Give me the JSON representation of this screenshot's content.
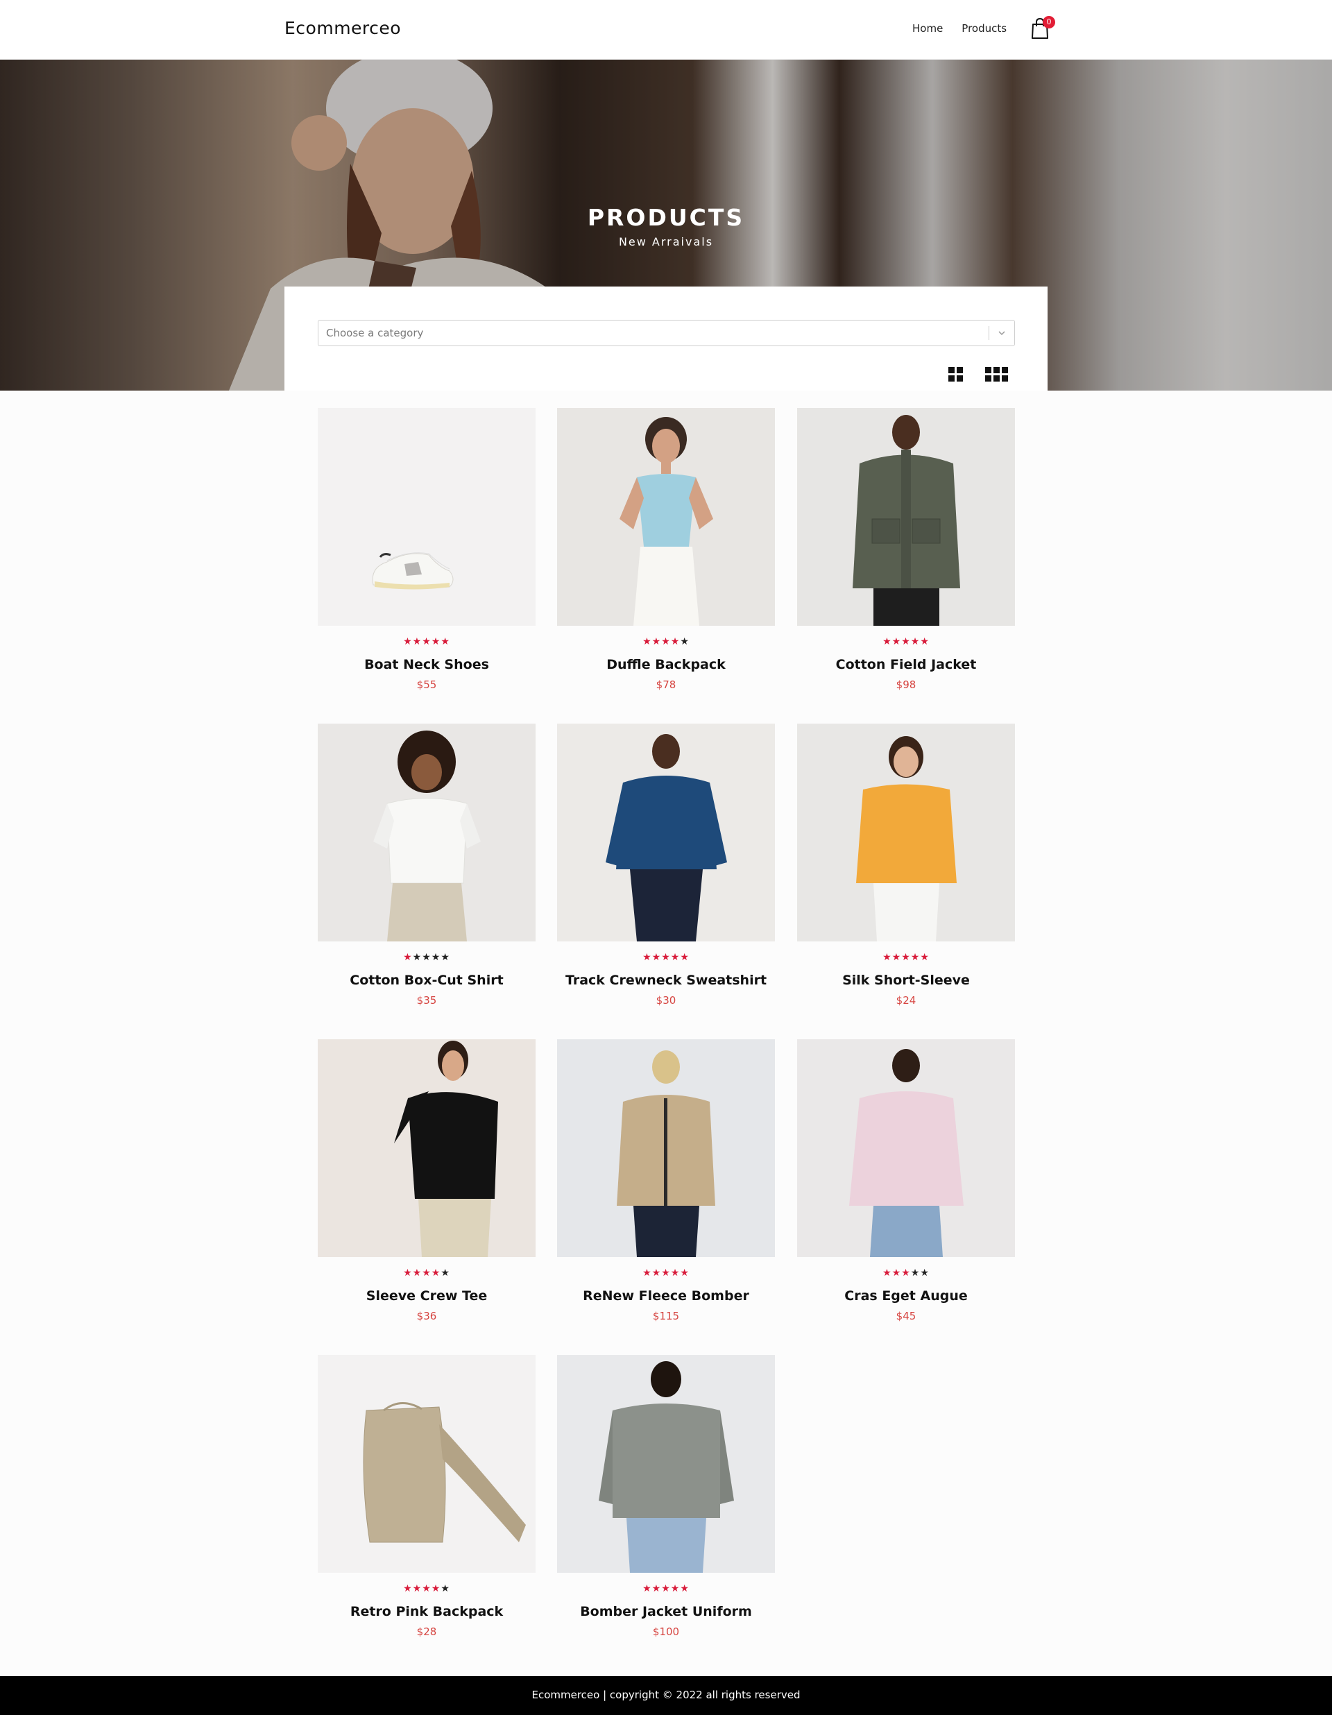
{
  "header": {
    "brand": "Ecommerceo",
    "nav": [
      {
        "label": "Home"
      },
      {
        "label": "Products"
      }
    ],
    "cart_count": "0"
  },
  "hero": {
    "title": "PRODUCTS",
    "subtitle": "New Arraivals"
  },
  "filters": {
    "category_placeholder": "Choose a category",
    "view_options": [
      {
        "icon": "grid-2x2-icon"
      },
      {
        "icon": "grid-3x2-icon"
      }
    ]
  },
  "colors": {
    "accent": "#e21d35",
    "star_filled": "#d81b3a",
    "star_empty": "#222222",
    "price": "#d64541"
  },
  "products": [
    {
      "name": "Boat Neck Shoes",
      "price": "$55",
      "rating": 5
    },
    {
      "name": "Duffle Backpack",
      "price": "$78",
      "rating": 4
    },
    {
      "name": "Cotton Field Jacket",
      "price": "$98",
      "rating": 5
    },
    {
      "name": "Cotton Box-Cut Shirt",
      "price": "$35",
      "rating": 1
    },
    {
      "name": "Track Crewneck Sweatshirt",
      "price": "$30",
      "rating": 5
    },
    {
      "name": "Silk Short-Sleeve",
      "price": "$24",
      "rating": 5
    },
    {
      "name": "Sleeve Crew Tee",
      "price": "$36",
      "rating": 4
    },
    {
      "name": "ReNew Fleece Bomber",
      "price": "$115",
      "rating": 5
    },
    {
      "name": "Cras Eget Augue",
      "price": "$45",
      "rating": 3
    },
    {
      "name": "Retro Pink Backpack",
      "price": "$28",
      "rating": 4
    },
    {
      "name": "Bomber Jacket Uniform",
      "price": "$100",
      "rating": 5
    }
  ],
  "footer": {
    "text": "Ecommerceo | copyright © 2022 all rights reserved"
  }
}
